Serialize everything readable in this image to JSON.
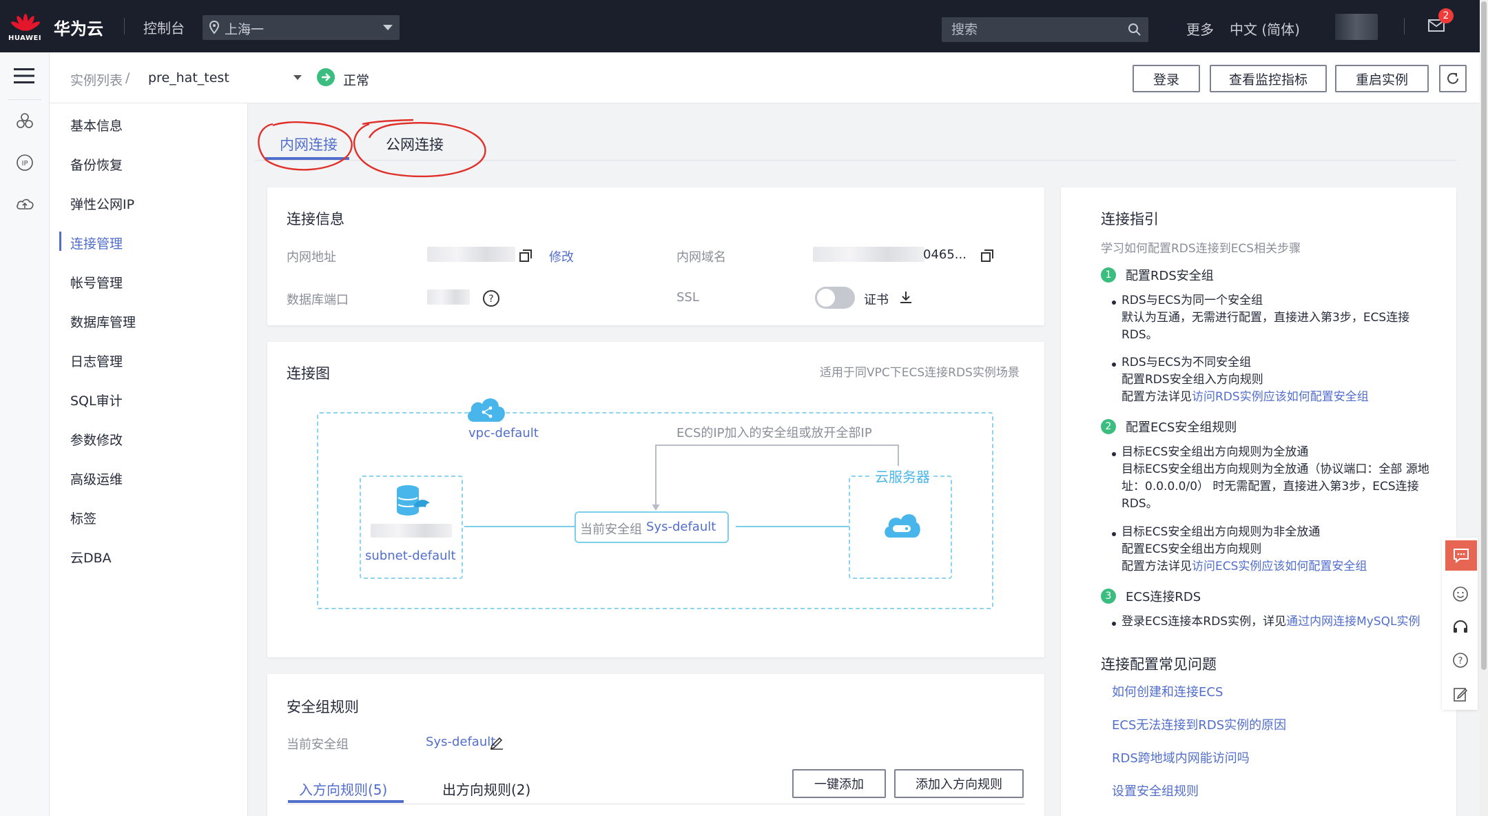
{
  "topbar": {
    "logo_text": "HUAWEI",
    "brand": "华为云",
    "console": "控制台",
    "region": "上海一",
    "search_placeholder": "搜索",
    "more": "更多",
    "language": "中文 (简体)",
    "notification_count": "2"
  },
  "header": {
    "breadcrumb_list": "实例列表",
    "breadcrumb_sep": "/",
    "instance_name": "pre_hat_test",
    "status": "正常",
    "buttons": {
      "login": "登录",
      "monitor": "查看监控指标",
      "restart": "重启实例"
    }
  },
  "subnav": {
    "items": [
      {
        "label": "基本信息"
      },
      {
        "label": "备份恢复"
      },
      {
        "label": "弹性公网IP"
      },
      {
        "label": "连接管理"
      },
      {
        "label": "帐号管理"
      },
      {
        "label": "数据库管理"
      },
      {
        "label": "日志管理"
      },
      {
        "label": "SQL审计"
      },
      {
        "label": "参数修改"
      },
      {
        "label": "高级运维"
      },
      {
        "label": "标签"
      },
      {
        "label": "云DBA"
      }
    ]
  },
  "tabs": {
    "private": "内网连接",
    "public": "公网连接"
  },
  "connection_info": {
    "title": "连接信息",
    "private_address_label": "内网地址",
    "modify": "修改",
    "private_domain_label": "内网域名",
    "private_domain_suffix": "0465...",
    "db_port_label": "数据库端口",
    "ssl_label": "SSL",
    "certificate": "证书"
  },
  "diagram": {
    "title": "连接图",
    "hint": "适用于同VPC下ECS连接RDS实例场景",
    "vpc": "vpc-default",
    "ecs_note": "ECS的IP加入的安全组或放开全部IP",
    "cloud_server": "云服务器",
    "sg_prefix": "当前安全组",
    "sg_name": "Sys-default",
    "subnet": "subnet-default"
  },
  "security": {
    "title": "安全组规则",
    "current_label": "当前安全组",
    "current_value": "Sys-default",
    "tab_in": "入方向规则(5)",
    "tab_out": "出方向规则(2)",
    "quick_add": "一键添加",
    "add_inbound": "添加入方向规则"
  },
  "guide": {
    "title": "连接指引",
    "subtitle": "学习如何配置RDS连接到ECS相关步骤",
    "step1": "配置RDS安全组",
    "s1a_title": "RDS与ECS为同一个安全组",
    "s1a_body": "默认为互通，无需进行配置，直接进入第3步，ECS连接RDS。",
    "s1b_title": "RDS与ECS为不同安全组",
    "s1b_body": "配置RDS安全组入方向规则",
    "s1b_pre": "配置方法详见",
    "s1b_link": "访问RDS实例应该如何配置安全组",
    "step2": "配置ECS安全组规则",
    "s2a_title": "目标ECS安全组出方向规则为全放通",
    "s2a_body": "目标ECS安全组出方向规则为全放通（协议端口：全部 源地址：0.0.0.0/0） 时无需配置，直接进入第3步，ECS连接RDS。",
    "s2b_title": "目标ECS安全组出方向规则为非全放通",
    "s2b_body": "配置ECS安全组出方向规则",
    "s2b_pre": "配置方法详见",
    "s2b_link": "访问ECS实例应该如何配置安全组",
    "step3": "ECS连接RDS",
    "s3_pre": "登录ECS连接本RDS实例，详见",
    "s3_link": "通过内网连接MySQL实例",
    "faq_title": "连接配置常见问题",
    "faq": [
      "如何创建和连接ECS",
      "ECS无法连接到RDS实例的原因",
      "RDS跨地域内网能访问吗",
      "设置安全组规则"
    ]
  },
  "colors": {
    "accent": "#526ecc",
    "topbar": "#1b1f2b",
    "success": "#3cbd80",
    "annotation": "#e0302a"
  }
}
